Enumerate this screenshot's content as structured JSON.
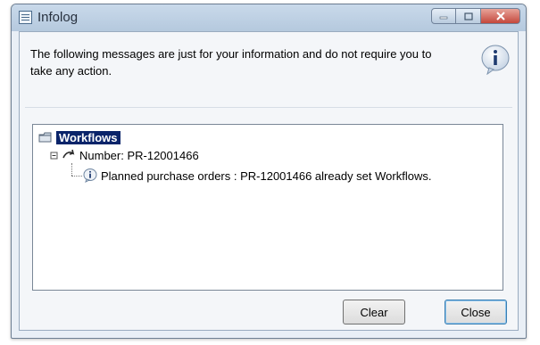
{
  "window": {
    "title": "Infolog",
    "accent_color": "#0a246a",
    "close_color": "#c4473b"
  },
  "message": "The following messages are just for your information and do not require you to take any action.",
  "tree": {
    "root": {
      "label": "Workflows",
      "icon": "folder-icon"
    },
    "child": {
      "label": "Number: PR-12001466",
      "icon": "arrow-icon"
    },
    "leaf": {
      "label": "Planned purchase orders : PR-12001466 already set Workflows.",
      "icon": "info-icon"
    }
  },
  "buttons": {
    "clear": "Clear",
    "close": "Close"
  }
}
